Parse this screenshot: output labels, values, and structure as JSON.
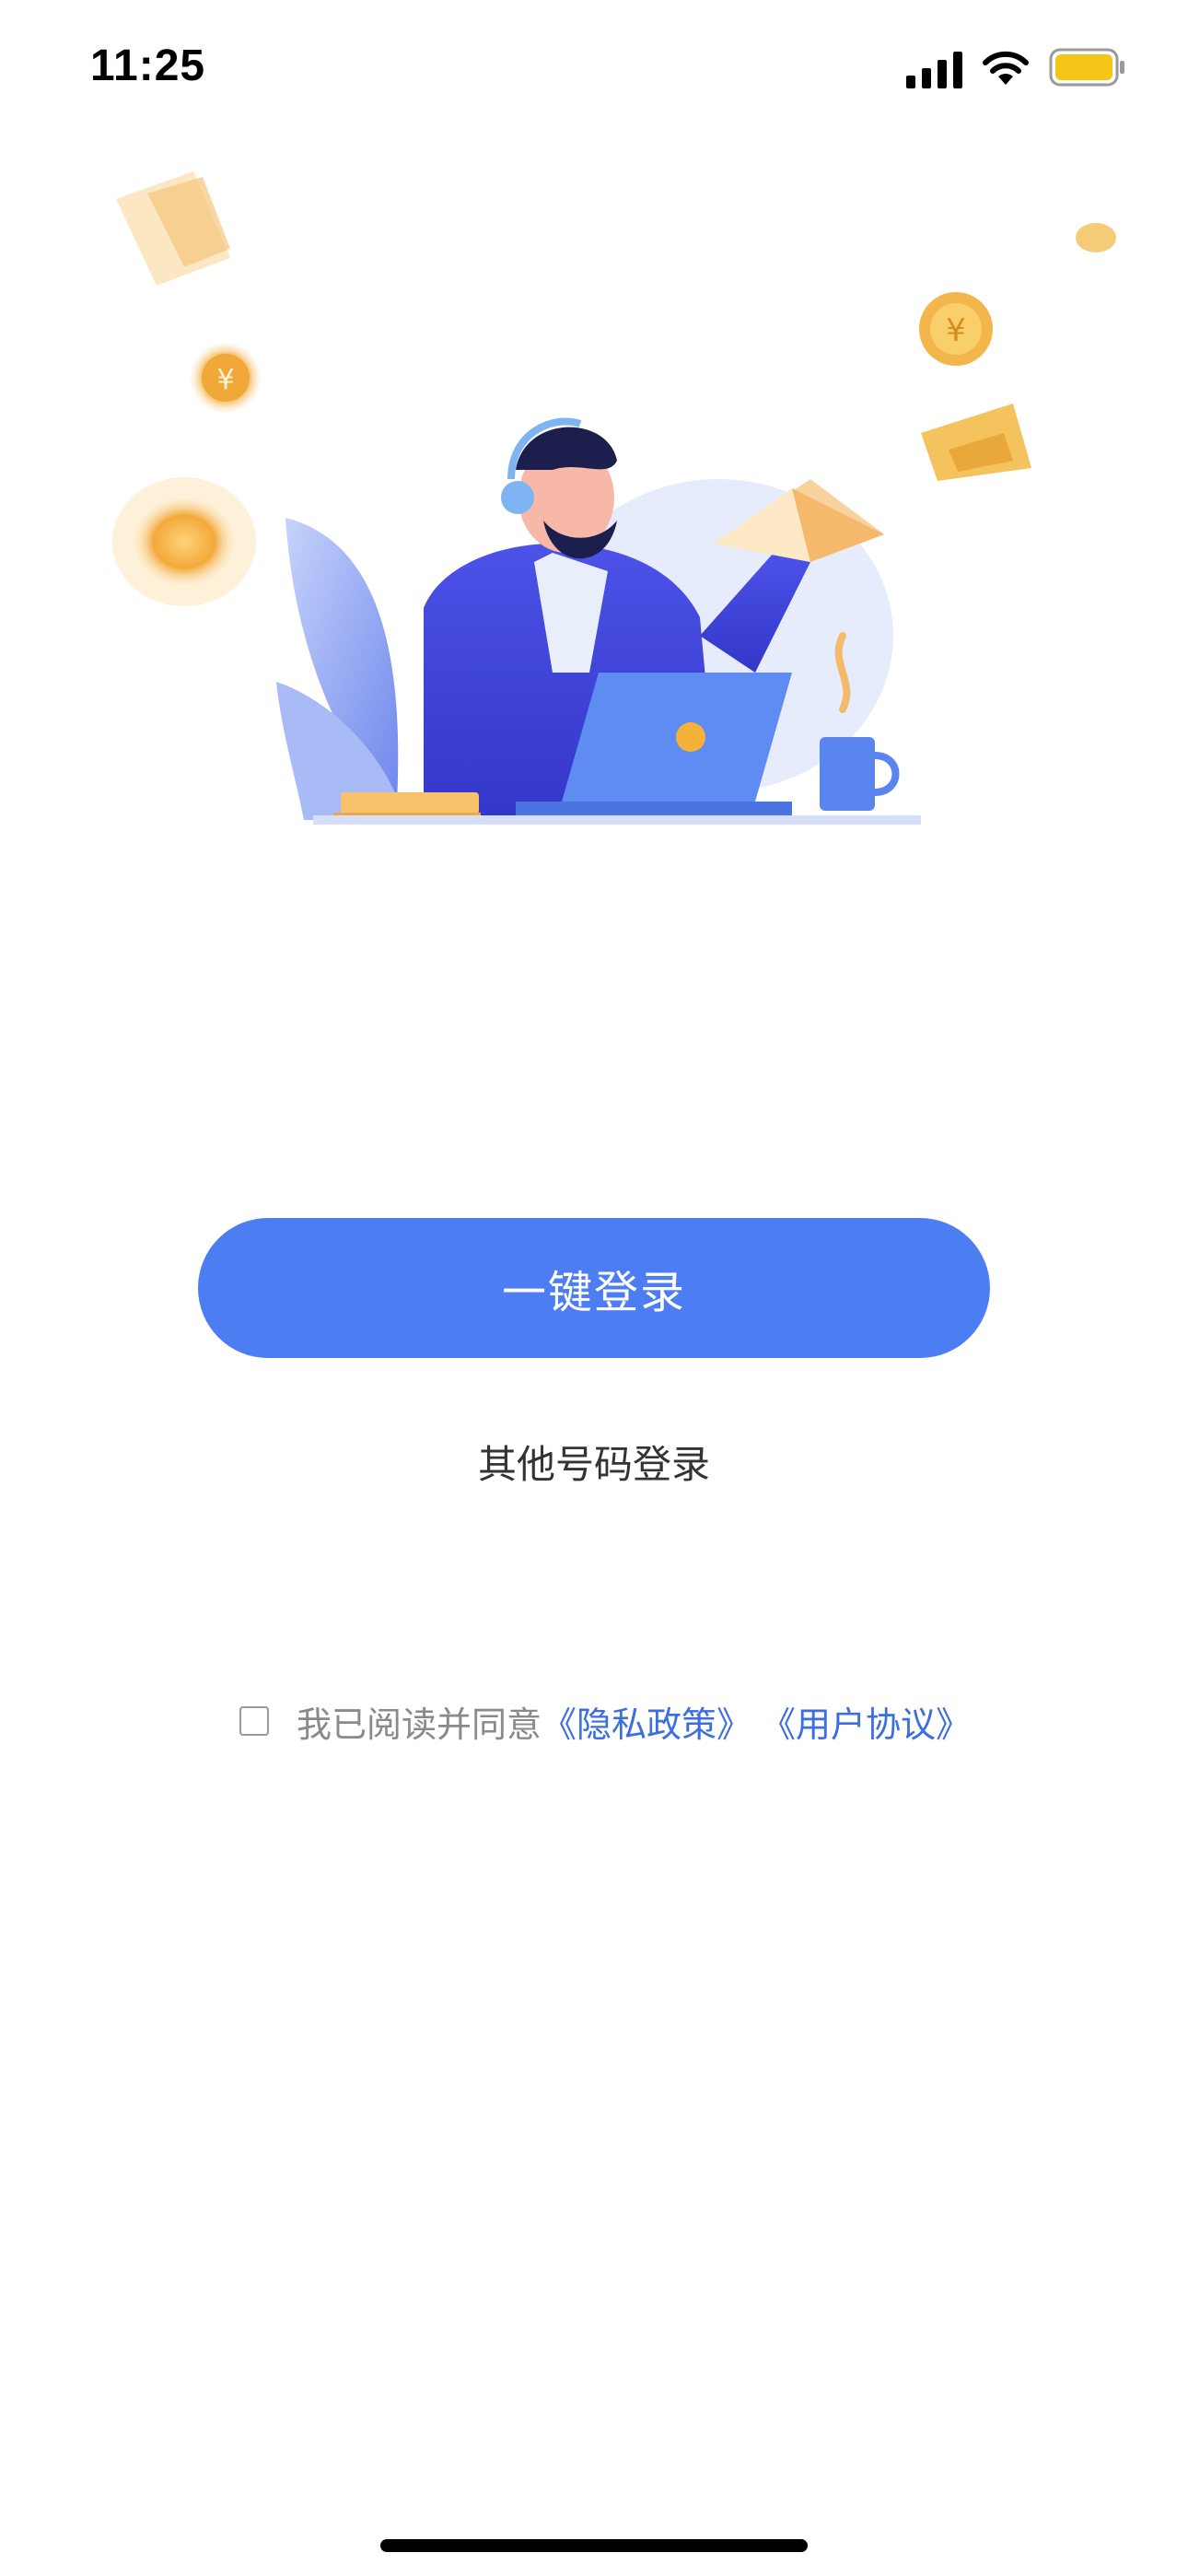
{
  "status_bar": {
    "time": "11:25",
    "battery_color": "#f5c518"
  },
  "login": {
    "one_click_label": "一键登录",
    "other_number_label": "其他号码登录"
  },
  "agreement": {
    "prefix": "我已阅读并同意",
    "privacy_policy": "《隐私政策》",
    "user_agreement": "《用户协议》",
    "checked": false
  },
  "colors": {
    "primary": "#4c7df3",
    "link": "#3d6ee0",
    "muted_text": "#8a8a8a"
  },
  "icons": [
    "signal-icon",
    "wifi-icon",
    "battery-icon"
  ]
}
